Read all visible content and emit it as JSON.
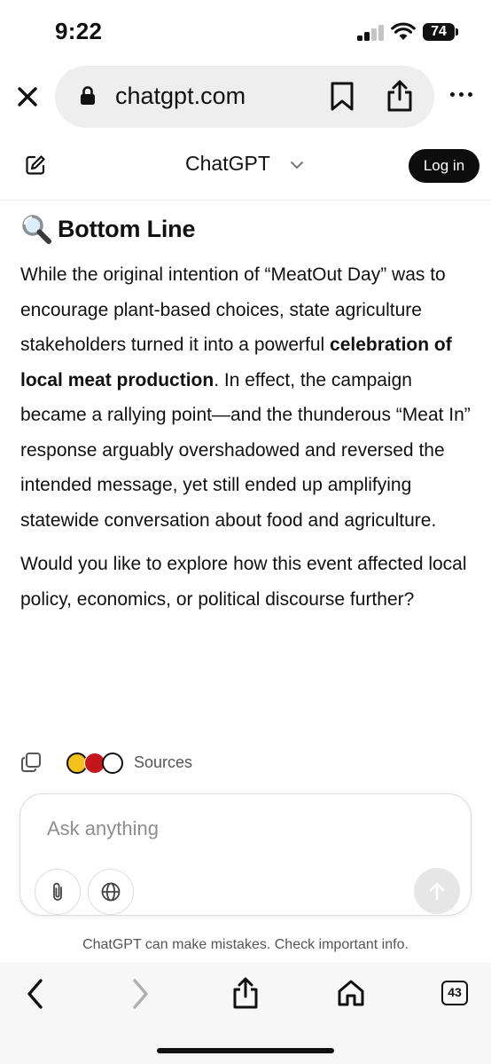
{
  "status_bar": {
    "time": "9:22",
    "battery": "74"
  },
  "browser": {
    "url": "chatgpt.com",
    "tab_count": "43"
  },
  "header": {
    "title": "ChatGPT",
    "login_label": "Log in"
  },
  "message": {
    "heading_emoji": "🔍",
    "heading": "Bottom Line",
    "p1_a": "While the original intention of “MeatOut Day” was to encourage plant-based choices, state agriculture stakeholders turned it into a powerful ",
    "p1_bold": "celebration of local meat production",
    "p1_b": ". In effect, the campaign became a rallying point—and the thunderous “Meat In” response arguably overshadowed and reversed the intended message, yet still ended up amplifying statewide conversation about food and agriculture.",
    "p2": "Would you like to explore how this event affected local policy, economics, or political discourse further?",
    "sources_label": "Sources"
  },
  "composer": {
    "placeholder": "Ask anything"
  },
  "disclaimer": "ChatGPT can make mistakes. Check important info.",
  "colors": {
    "login_bg": "#0d0d0d",
    "pill_bg": "#eeeeef",
    "send_disabled": "#e6e6e6",
    "muted_text": "#555555"
  }
}
